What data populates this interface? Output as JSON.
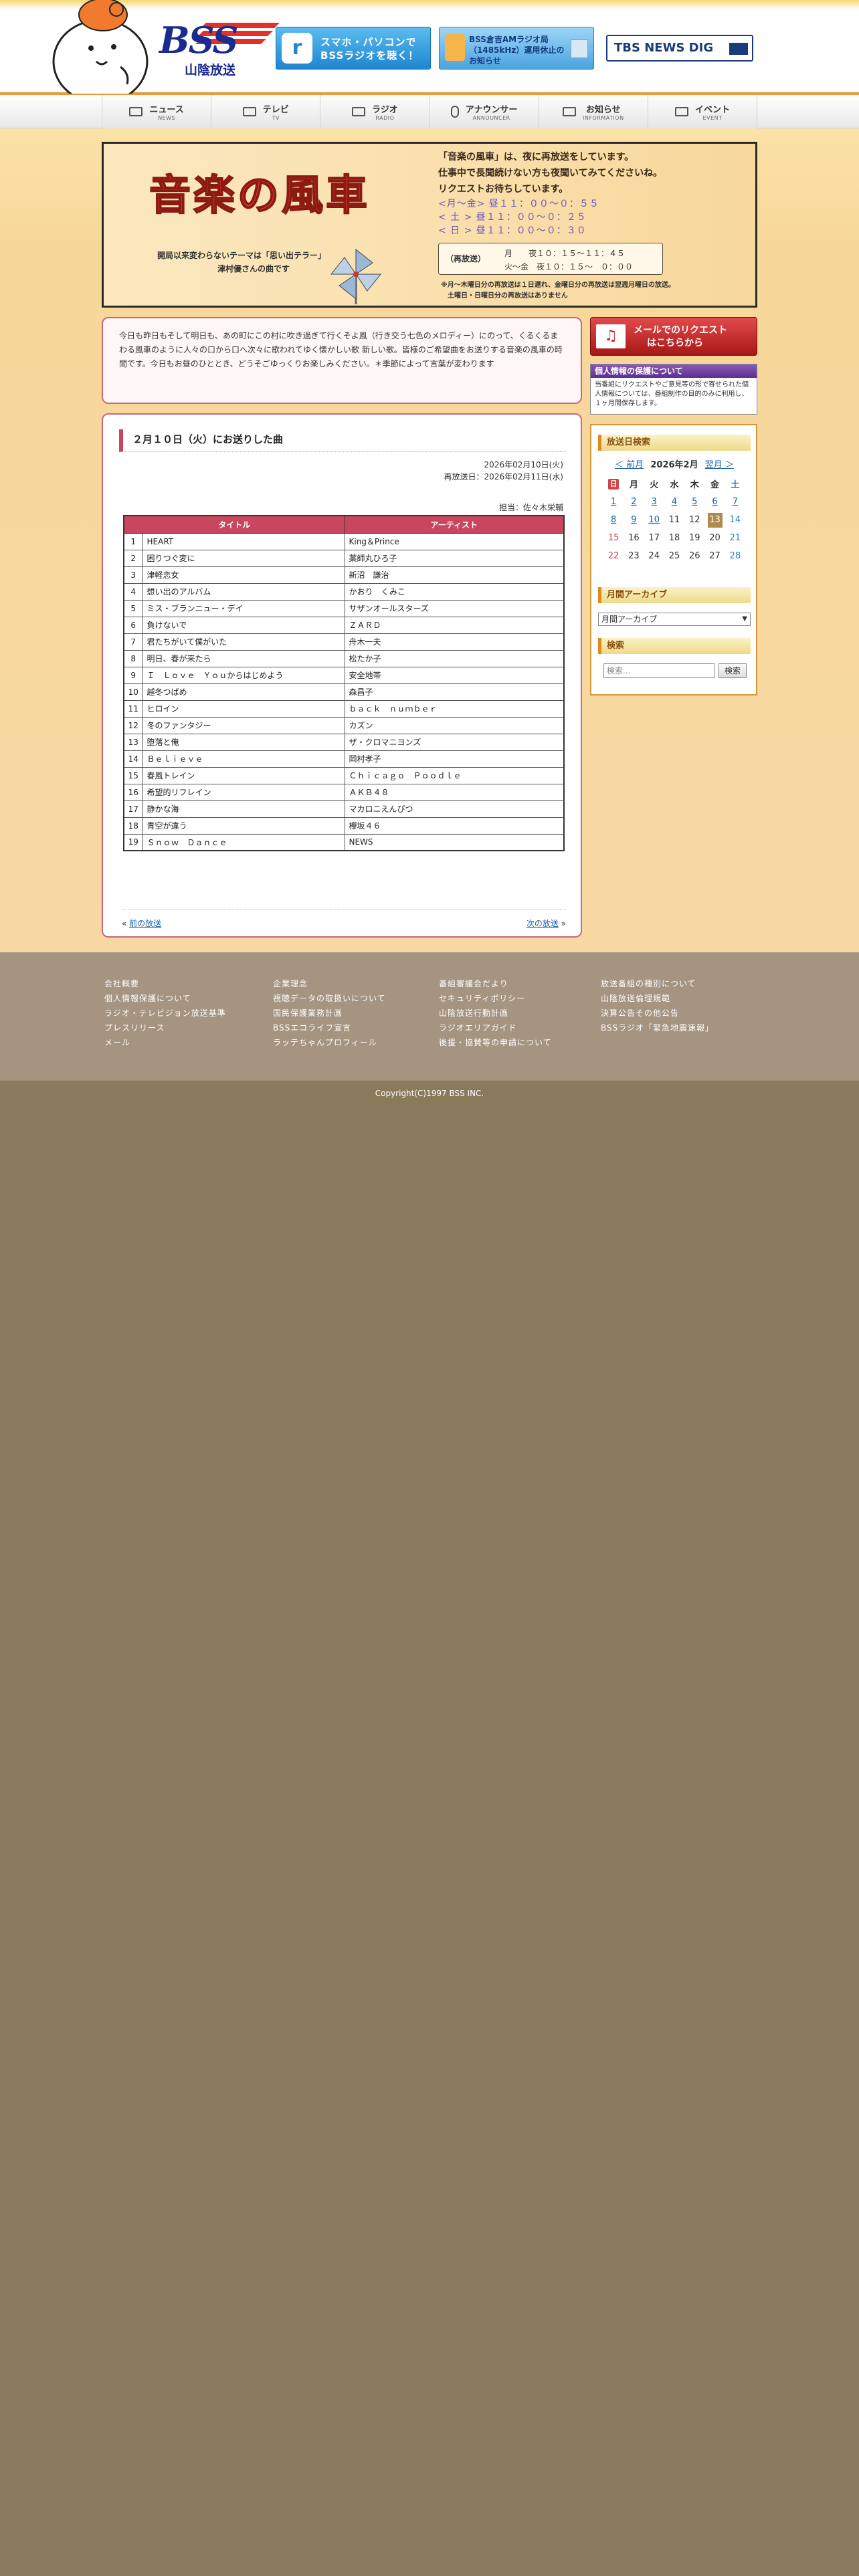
{
  "header": {
    "logo_text": "BSS",
    "logo_sub": "山陰放送",
    "banners": {
      "radio": "スマホ・パソコンで BSSラジオを聴く！",
      "am": "BSS倉吉AMラジオ局（1485kHz）運用休止のお知らせ",
      "tbs": "TBS NEWS DIG"
    }
  },
  "nav": [
    {
      "jp": "ニュース",
      "en": "NEWS"
    },
    {
      "jp": "テレビ",
      "en": "TV"
    },
    {
      "jp": "ラジオ",
      "en": "RADIO"
    },
    {
      "jp": "アナウンサー",
      "en": "ANNOUNCER"
    },
    {
      "jp": "お知らせ",
      "en": "INFORMATION"
    },
    {
      "jp": "イベント",
      "en": "EVENT"
    }
  ],
  "hero": {
    "title": "音楽の風車",
    "subtitle1": "開局以来変わらないテーマは「思い出テラー」",
    "subtitle2": "津村優さんの曲です",
    "intro_line1": "「音楽の風車」は、夜に再放送をしています。",
    "intro_line2": "仕事中で長聞続けない方も夜聞いてみてくださいね。",
    "intro_line3": "リクエストお待ちしています。",
    "sched1": "<月～金> 昼１１：００～０：５５",
    "sched2": "< 土 > 昼１１：００～０：２５",
    "sched3": "< 日 > 昼１１：００～０：３０",
    "rebroadcast_tag": "（再放送）",
    "rebroadcast_a": "月　　夜１０：１５～１１：４５",
    "rebroadcast_b": "火～金　夜１０：１５～　０：００",
    "note1": "※月～木曜日分の再放送は１日遅れ、金曜日分の再放送は翌週月曜日の放送。",
    "note2": "土曜日・日曜日分の再放送はありません"
  },
  "intro": "今日も昨日もそして明日も、あの町にこの村に吹き過ぎて行くそよ風（行き交う七色のメロディー）にのって、くるくるまわる風車のように人々の口から口へ次々に歌われてゆく懐かしい歌 新しい歌。皆様のご希望曲をお送りする音楽の風車の時間です。今日もお昼のひととき、どうそごゆっくりお楽しみください。＊季節によって言葉が変わります",
  "post": {
    "title": "２月１０日（火）にお送りした曲",
    "aired": "2026年02月10日(火)",
    "rebroadcast": "再放送日：2026年02月11日(水)",
    "staff": "担当：佐々木栄輔",
    "col_title": "タイトル",
    "col_artist": "アーティスト",
    "songs": [
      {
        "n": "1",
        "title": "HEART",
        "artist": "King＆Prince"
      },
      {
        "n": "2",
        "title": "困りつぐ変に",
        "artist": "薬師丸ひろ子"
      },
      {
        "n": "3",
        "title": "津軽恋女",
        "artist": "新沼　謙治"
      },
      {
        "n": "4",
        "title": "想い出のアルバム",
        "artist": "かおり　くみこ"
      },
      {
        "n": "5",
        "title": "ミス・ブランニュー・デイ",
        "artist": "サザンオールスターズ"
      },
      {
        "n": "6",
        "title": "負けないで",
        "artist": "ＺＡＲＤ"
      },
      {
        "n": "7",
        "title": "君たちがいて僕がいた",
        "artist": "舟木一夫"
      },
      {
        "n": "8",
        "title": "明日、春が来たら",
        "artist": "松たか子"
      },
      {
        "n": "9",
        "title": "Ｉ　Ｌｏｖｅ　Ｙｏｕからはじめよう",
        "artist": "安全地帯"
      },
      {
        "n": "10",
        "title": "越冬つばめ",
        "artist": "森昌子"
      },
      {
        "n": "11",
        "title": "ヒロイン",
        "artist": "ｂａｃｋ　ｎｕｍｂｅｒ"
      },
      {
        "n": "12",
        "title": "冬のファンタジー",
        "artist": "カズン"
      },
      {
        "n": "13",
        "title": "堕落と俺",
        "artist": "ザ・クロマニヨンズ"
      },
      {
        "n": "14",
        "title": "Ｂｅｌｉｅｖｅ",
        "artist": "岡村孝子"
      },
      {
        "n": "15",
        "title": "春風トレイン",
        "artist": "Ｃｈｉｃａｇｏ　Ｐｏｏｄｌｅ"
      },
      {
        "n": "16",
        "title": "希望的リフレイン",
        "artist": "ＡＫＢ４８"
      },
      {
        "n": "17",
        "title": "静かな海",
        "artist": "マカロニえんぴつ"
      },
      {
        "n": "18",
        "title": "青空が違う",
        "artist": "欅坂４６"
      },
      {
        "n": "19",
        "title": "Ｓｎｏｗ　Ｄａｎｃｅ",
        "artist": "NEWS"
      }
    ],
    "prev": "前の放送",
    "next": "次の放送"
  },
  "sidebar": {
    "mail_line1": "メールでのリクエスト",
    "mail_line2": "はこちらから",
    "privacy_title": "個人情報の保護について",
    "privacy_body": "当番組にリクエストやご意見等の形で寄せられた個人情報については、番組制作の目的のみに利用し、１ヶ月間保存します。",
    "calendar_title": "放送日検索",
    "cal_prev": "＜ 前月",
    "cal_month": "2026年2月",
    "cal_next": "翌月 ＞",
    "weekdays": [
      "日",
      "月",
      "火",
      "水",
      "木",
      "金",
      "土"
    ],
    "weeks": [
      [
        "1",
        "2",
        "3",
        "4",
        "5",
        "6",
        "7"
      ],
      [
        "8",
        "9",
        "10",
        "11",
        "12",
        "13",
        "14"
      ],
      [
        "15",
        "16",
        "17",
        "18",
        "19",
        "20",
        "21"
      ],
      [
        "22",
        "23",
        "24",
        "25",
        "26",
        "27",
        "28"
      ]
    ],
    "archive_title": "月間アーカイブ",
    "archive_value": "月間アーカイブ",
    "search_title": "検索",
    "search_placeholder": "検索...",
    "search_btn": "検索"
  },
  "footer": {
    "col1": [
      "会社概要",
      "個人情報保護について",
      "ラジオ・テレビジョン放送基準",
      "プレスリリース",
      "メール"
    ],
    "col2": [
      "企業理念",
      "視聴データの取扱いについて",
      "国民保護業務計画",
      "BSSエコライフ宣言",
      "ラッテちゃんプロフィール"
    ],
    "col3": [
      "番組審議会だより",
      "セキュリティポリシー",
      "山陰放送行動計画",
      "ラジオエリアガイド",
      "後援・協賛等の申請について"
    ],
    "col4": [
      "放送番組の種別について",
      "山陰放送倫理規範",
      "決算公告その他公告",
      "BSSラジオ「緊急地震速報」"
    ],
    "copyright": "Copyright(C)1997 BSS INC."
  }
}
